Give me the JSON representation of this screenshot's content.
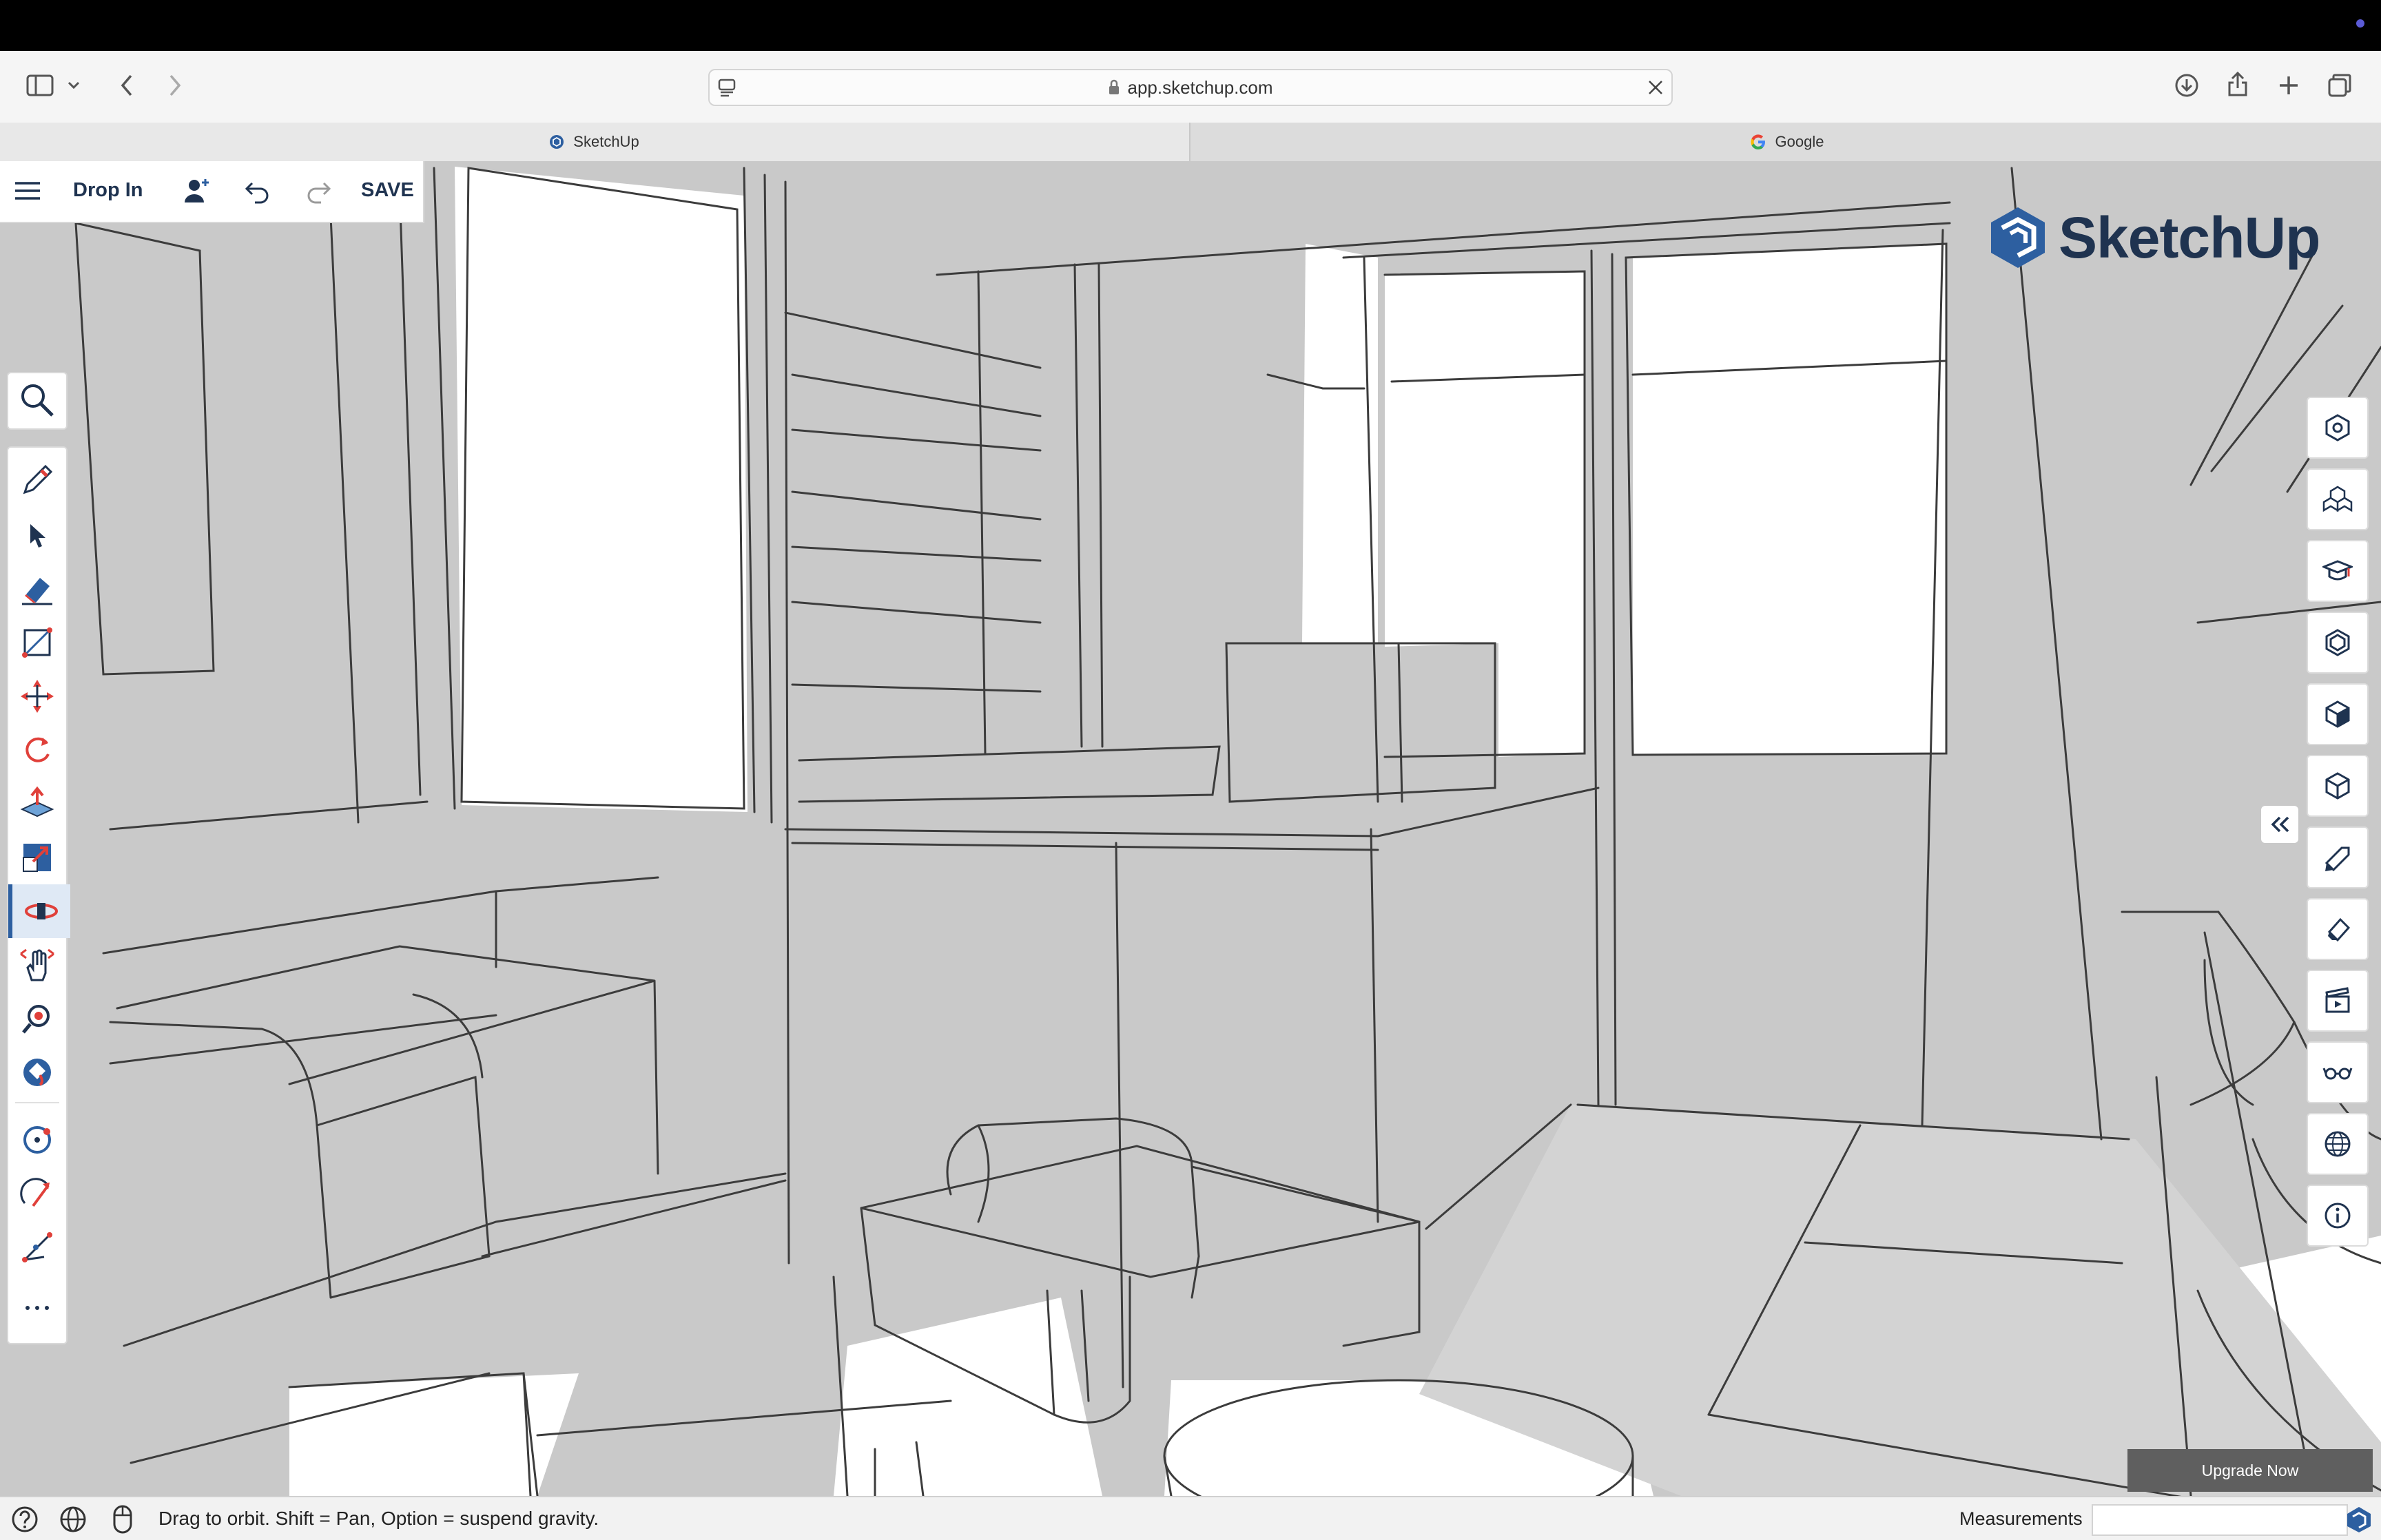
{
  "browser": {
    "url": "app.sketchup.com",
    "tabs": [
      {
        "label": "SketchUp",
        "active": true
      },
      {
        "label": "Google",
        "active": false
      }
    ]
  },
  "app": {
    "title": "Drop In",
    "save_label": "SAVE",
    "logo_text": "SketchUp",
    "upgrade_label": "Upgrade Now",
    "status_text": "Drag to orbit. Shift = Pan, Option = suspend gravity.",
    "measurements_label": "Measurements",
    "measurements_value": ""
  },
  "colors": {
    "brand": "#1f3350",
    "accent_blue": "#2d5fa0",
    "tool_red": "#e0403a",
    "viewport_gray": "#c9c9c9"
  },
  "left_tools": [
    "search-icon",
    "pencil-icon",
    "select-arrow-icon",
    "eraser-icon",
    "rectangle-icon",
    "move-icon",
    "rotate-icon",
    "push-pull-icon",
    "scale-icon",
    "orbit-icon",
    "pan-icon",
    "zoom-extents-icon",
    "paint-bucket-icon",
    "tape-measure-icon",
    "arc-icon",
    "protractor-icon",
    "more-icon"
  ],
  "right_tools": [
    "entity-info-icon",
    "components-icon",
    "instructor-icon",
    "materials-icon",
    "styles-icon",
    "outliner-icon",
    "tags-icon",
    "soften-icon",
    "scenes-icon",
    "display-icon",
    "geo-location-icon",
    "info-icon"
  ]
}
